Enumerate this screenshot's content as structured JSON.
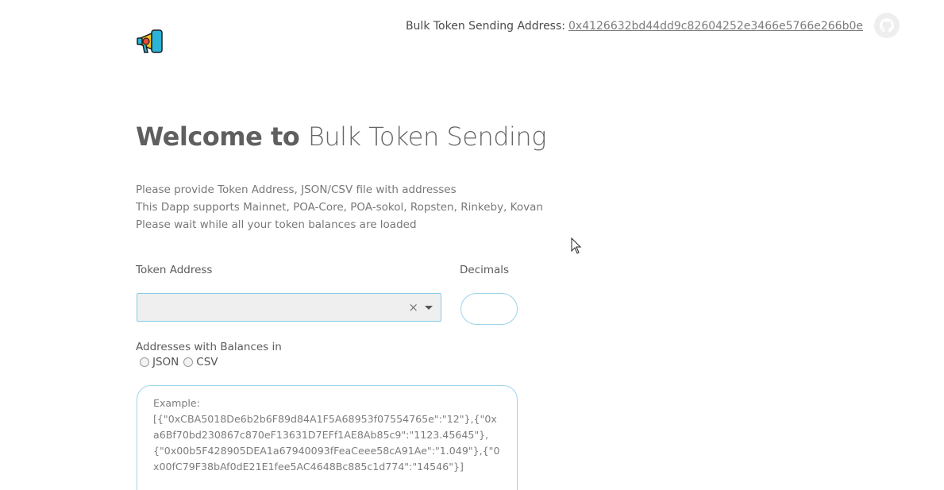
{
  "header": {
    "address_label": "Bulk Token Sending Address:",
    "address_value": "0x4126632bd44dd9c82604252e3466e5766e266b0e",
    "github_icon": "github-icon",
    "logo_icon": "megaphone-icon"
  },
  "welcome": {
    "strong": "Welcome to",
    "light": "Bulk Token Sending"
  },
  "intro": {
    "line1": "Please provide Token Address, JSON/CSV file with addresses",
    "line2": "This Dapp supports Mainnet, POA-Core, POA-sokol, Ropsten, Rinkeby, Kovan",
    "line3": "Please wait while all your token balances are loaded"
  },
  "form": {
    "token_label": "Token Address",
    "token_value": "",
    "clear_symbol": "×",
    "decimals_label": "Decimals",
    "decimals_value": "",
    "addresses_label": "Addresses with Balances in",
    "formats": [
      "JSON",
      "CSV"
    ],
    "placeholder": "Example:\n[{\"0xCBA5018De6b2b6F89d84A1F5A68953f07554765e\":\"12\"},{\"0xa6Bf70bd230867c870eF13631D7EFf1AE8Ab85c9\":\"1123.45645\"},{\"0x00b5F428905DEA1a67940093fFeaCeee58cA91Ae\":\"1.049\"},{\"0x00fC79F38bAf0dE21E1fee5AC4648Bc885c1d774\":\"14546\"}]"
  },
  "colors": {
    "accent": "#86cde8",
    "select_bg": "#efefef"
  }
}
